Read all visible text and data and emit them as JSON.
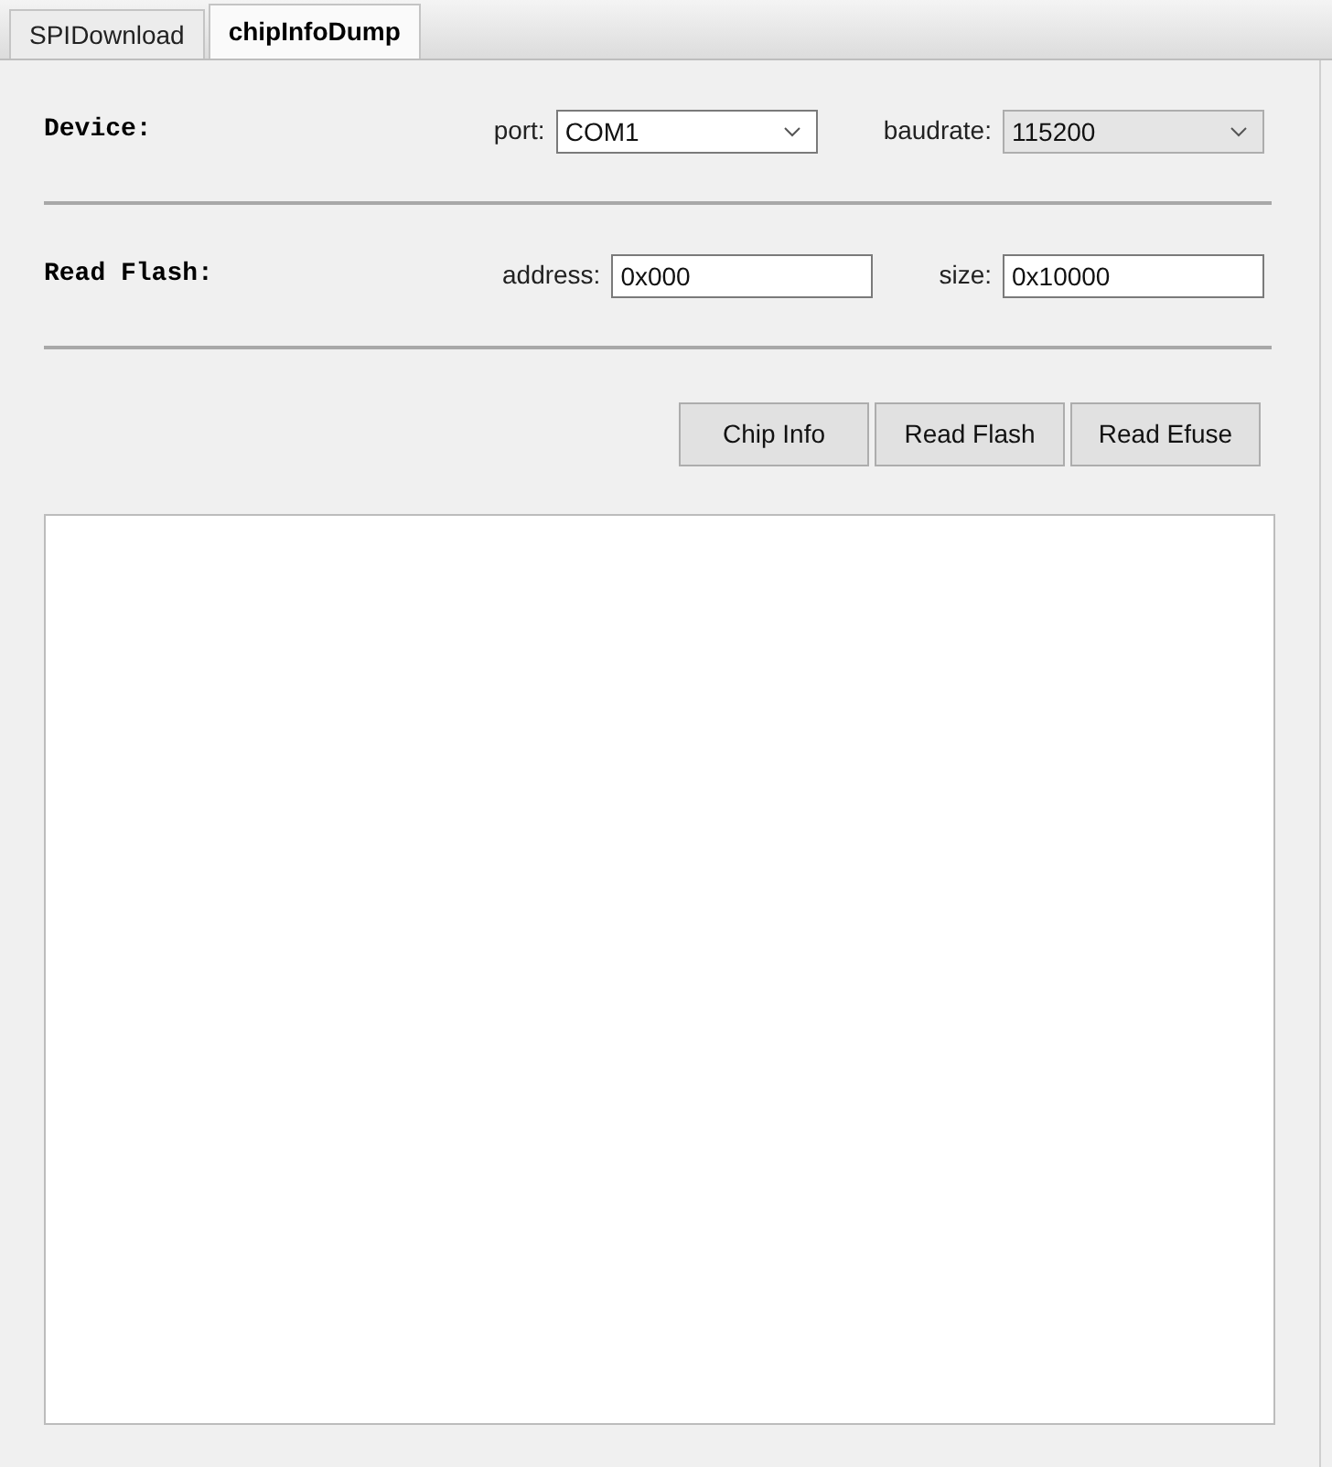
{
  "tabs": [
    {
      "label": "SPIDownload",
      "selected": false
    },
    {
      "label": "chipInfoDump",
      "selected": true
    }
  ],
  "sections": [
    {
      "title": "Device:",
      "fields": [
        {
          "kind": "combo",
          "label": "port:",
          "value": "COM1",
          "editable": true
        },
        {
          "kind": "combo",
          "label": "baudrate:",
          "value": "115200",
          "editable": false
        }
      ]
    },
    {
      "title": "Read Flash:",
      "fields": [
        {
          "kind": "text",
          "label": "address:",
          "value": "0x000"
        },
        {
          "kind": "text",
          "label": "size:",
          "value": "0x10000"
        }
      ]
    }
  ],
  "buttons": [
    "Chip Info",
    "Read Flash",
    "Read Efuse"
  ]
}
